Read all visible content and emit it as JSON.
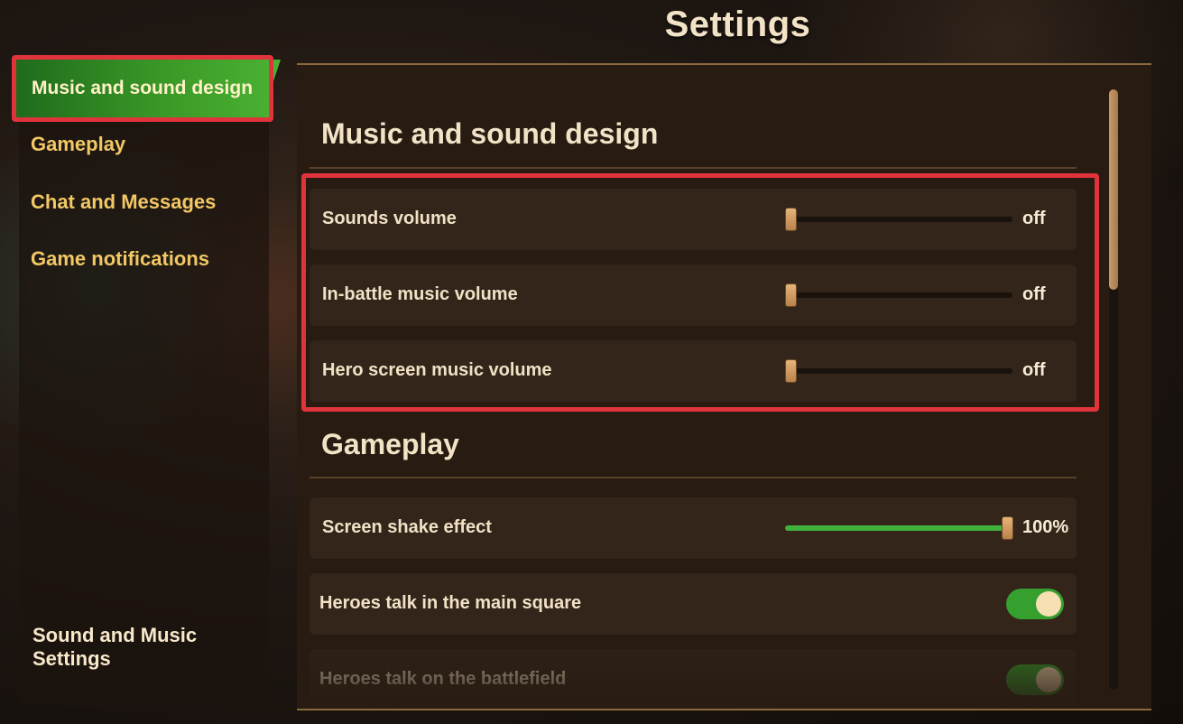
{
  "title": "Settings",
  "sidebar": {
    "items": [
      {
        "label": "Music and sound design",
        "active": true
      },
      {
        "label": "Gameplay",
        "active": false
      },
      {
        "label": "Chat and Messages",
        "active": false
      },
      {
        "label": "Game notifications",
        "active": false
      }
    ],
    "footer": "Sound and Music Settings"
  },
  "sections": {
    "music": {
      "title": "Music and sound design",
      "rows": [
        {
          "label": "Sounds volume",
          "value": "off",
          "level": 0
        },
        {
          "label": "In-battle music volume",
          "value": "off",
          "level": 0
        },
        {
          "label": "Hero screen music volume",
          "value": "off",
          "level": 0
        }
      ]
    },
    "gameplay": {
      "title": "Gameplay",
      "rows": [
        {
          "label": "Screen shake effect",
          "value": "100%",
          "level": 1
        },
        {
          "label": "Heroes talk in the main square",
          "toggle": true
        },
        {
          "label": "Heroes talk on the battlefield",
          "toggle": true
        }
      ]
    }
  },
  "colors": {
    "accent_green": "#3fb13a",
    "highlight_red": "#e0333c",
    "nav_text": "#f2c864"
  }
}
